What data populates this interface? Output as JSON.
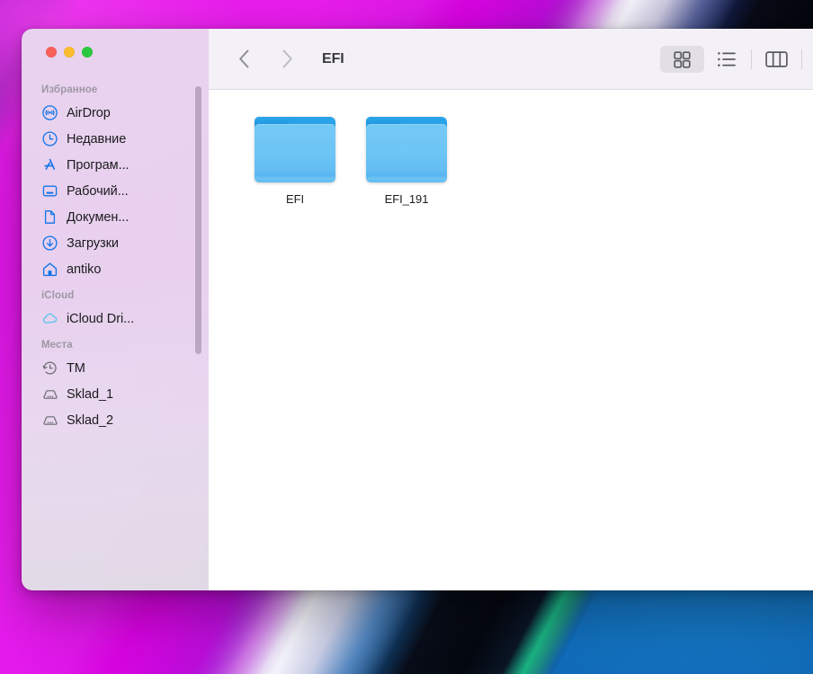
{
  "window": {
    "title": "EFI",
    "traffic_lights": [
      {
        "name": "close",
        "color": "#f9605a"
      },
      {
        "name": "minimize",
        "color": "#fbbd2e"
      },
      {
        "name": "maximize",
        "color": "#2bc93f"
      }
    ]
  },
  "toolbar": {
    "back_icon": "chevron-left-icon",
    "forward_icon": "chevron-right-icon",
    "view_buttons": [
      {
        "name": "icon-view",
        "icon": "grid-icon",
        "active": true
      },
      {
        "name": "list-view",
        "icon": "list-icon",
        "active": false
      },
      {
        "name": "column-view",
        "icon": "columns-icon",
        "active": false
      },
      {
        "name": "gallery-view",
        "icon": "gallery-icon",
        "active": false
      }
    ]
  },
  "sidebar": {
    "sections": [
      {
        "title": "Избранное",
        "items": [
          {
            "label": "AirDrop",
            "icon": "airdrop-icon"
          },
          {
            "label": "Недавние",
            "icon": "clock-icon"
          },
          {
            "label": "Програм...",
            "icon": "applications-icon"
          },
          {
            "label": "Рабочий...",
            "icon": "desktop-icon"
          },
          {
            "label": "Докумен...",
            "icon": "document-icon"
          },
          {
            "label": "Загрузки",
            "icon": "download-icon"
          },
          {
            "label": "antiko",
            "icon": "home-icon"
          }
        ]
      },
      {
        "title": "iCloud",
        "items": [
          {
            "label": "iCloud Dri...",
            "icon": "cloud-icon"
          }
        ]
      },
      {
        "title": "Места",
        "items": [
          {
            "label": "TM",
            "icon": "time-machine-icon"
          },
          {
            "label": "Sklad_1",
            "icon": "drive-icon"
          },
          {
            "label": "Sklad_2",
            "icon": "drive-icon"
          }
        ]
      }
    ]
  },
  "content": {
    "files": [
      {
        "name": "EFI",
        "type": "folder"
      },
      {
        "name": "EFI_191",
        "type": "folder"
      }
    ]
  },
  "colors": {
    "folder_blue": "#64bef2",
    "sidebar_icon_blue": "#1274e8",
    "accent_magenta": "#e313ea"
  }
}
